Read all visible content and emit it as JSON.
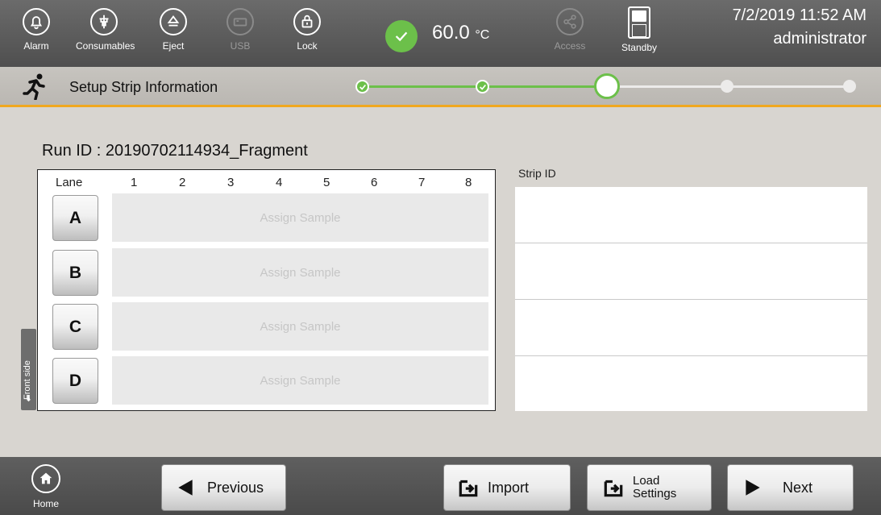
{
  "topbar": {
    "alarm_label": "Alarm",
    "consumables_label": "Consumables",
    "eject_label": "Eject",
    "usb_label": "USB",
    "lock_label": "Lock",
    "temperature_value": "60.0",
    "temperature_unit": "°C",
    "access_label": "Access",
    "standby_label": "Standby",
    "datetime": "7/2/2019 11:52 AM",
    "user": "administrator"
  },
  "stepbar": {
    "title": "Setup Strip Information",
    "steps_completed": 2,
    "current_step": 3,
    "total_steps": 5
  },
  "main": {
    "run_id": "Run ID :  20190702114934_Fragment",
    "lane_header": "Lane",
    "columns": [
      "1",
      "2",
      "3",
      "4",
      "5",
      "6",
      "7",
      "8"
    ],
    "lanes": [
      {
        "label": "A",
        "cell_text": "Assign Sample"
      },
      {
        "label": "B",
        "cell_text": "Assign Sample"
      },
      {
        "label": "C",
        "cell_text": "Assign Sample"
      },
      {
        "label": "D",
        "cell_text": "Assign Sample"
      }
    ],
    "front_side_label": "Front side",
    "strip_id_label": "Strip ID",
    "strip_ids": [
      "",
      "",
      "",
      ""
    ]
  },
  "bottombar": {
    "home_label": "Home",
    "previous_label": "Previous",
    "import_label": "Import",
    "load_settings_label_1": "Load",
    "load_settings_label_2": "Settings",
    "next_label": "Next"
  },
  "colors": {
    "accent_green": "#6cc04a",
    "accent_orange": "#f0a81f"
  }
}
